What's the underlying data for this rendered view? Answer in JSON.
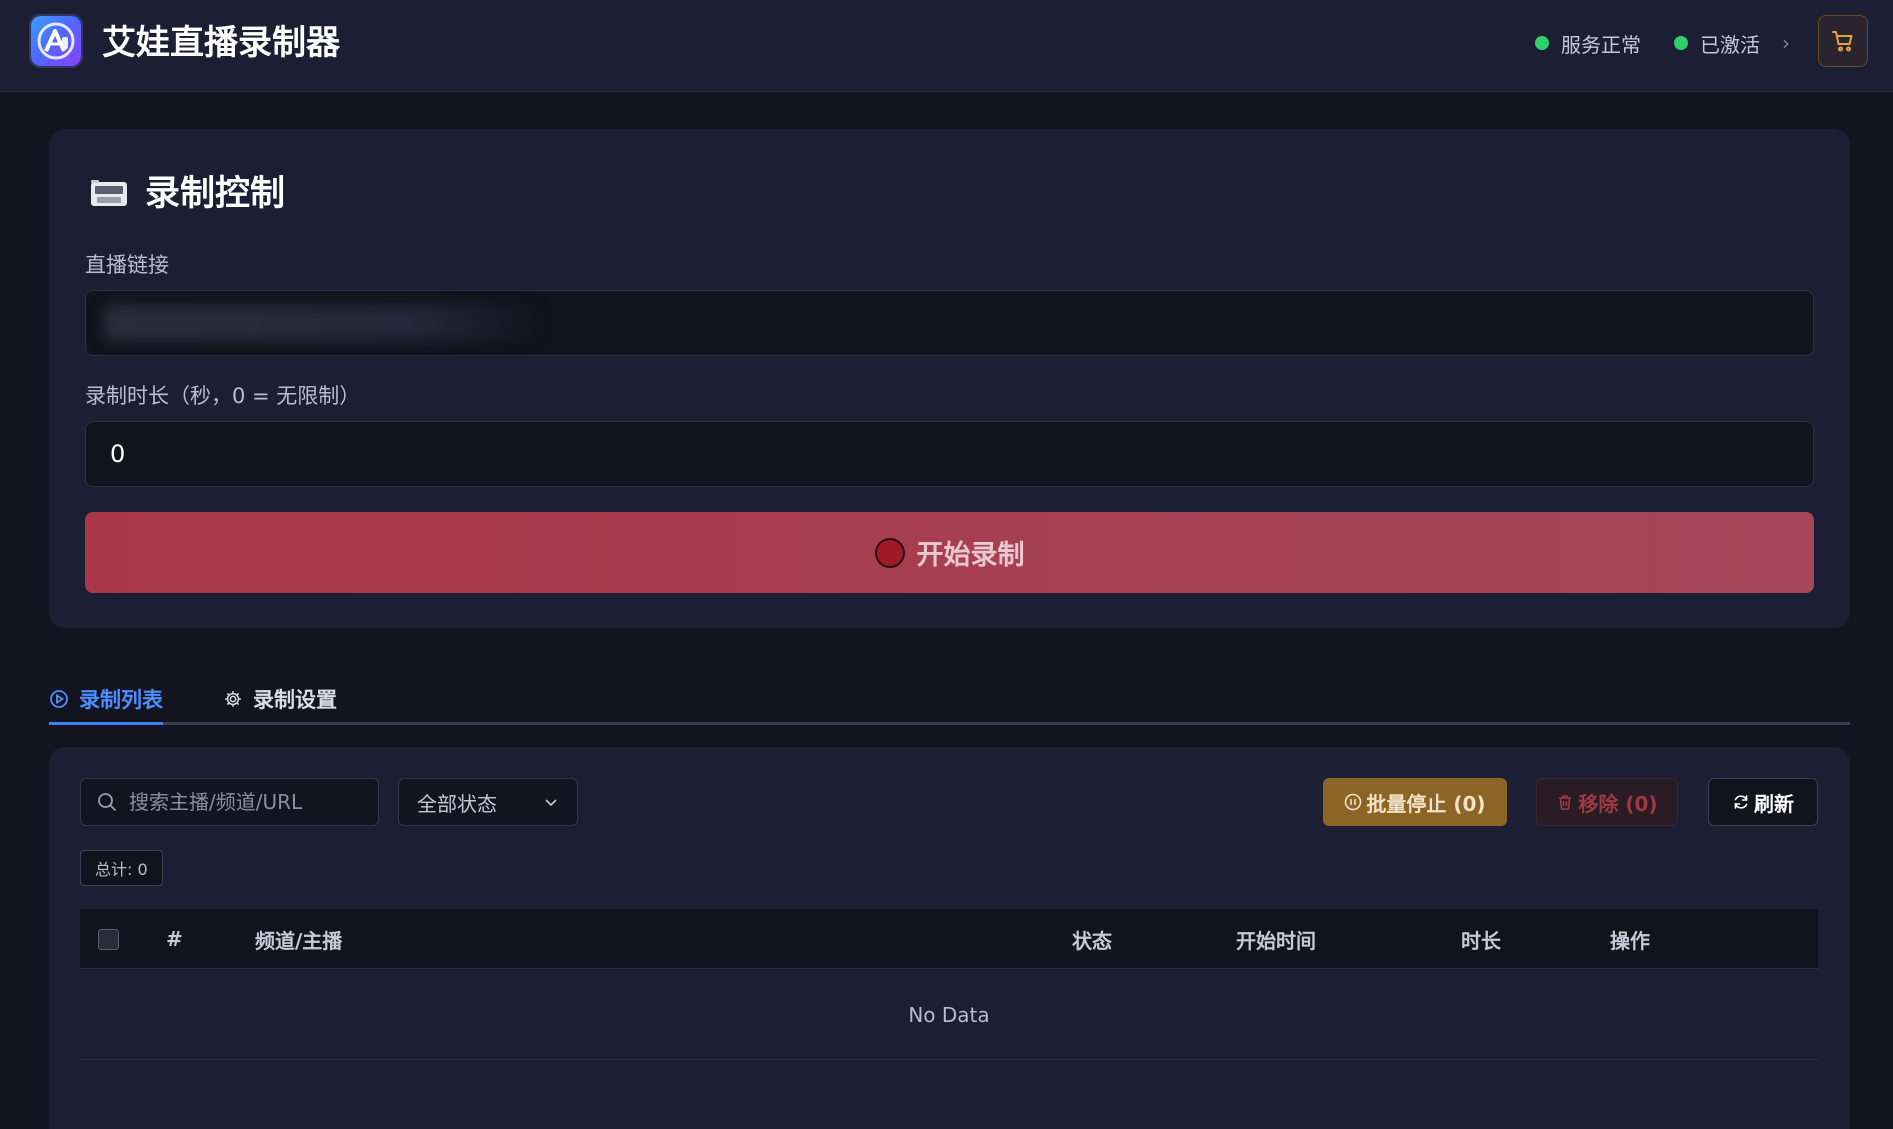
{
  "header": {
    "app_title": "艾娃直播录制器",
    "status_service": "服务正常",
    "status_activated": "已激活",
    "chevron": "›",
    "icons": {
      "logo": "app-logo-icon",
      "cart": "cart-icon"
    },
    "colors": {
      "status_ok": "#2fcf6a",
      "cart_accent": "#e8a23a"
    }
  },
  "control": {
    "title": "录制控制",
    "link_label": "直播链接",
    "link_value": "",
    "duration_label": "录制时长（秒，0 = 无限制）",
    "duration_value": "0",
    "start_button": "开始录制",
    "colors": {
      "start_button": "#a93748",
      "record_dot": "#a11828"
    }
  },
  "tabs": [
    {
      "label": "录制列表",
      "icon": "play-circle-icon",
      "active": true
    },
    {
      "label": "录制设置",
      "icon": "gear-icon",
      "active": false
    }
  ],
  "toolbar": {
    "search_placeholder": "搜索主播/频道/URL",
    "status_filter": "全部状态",
    "batch_stop": "批量停止 (0)",
    "remove": "移除 (0)",
    "refresh": "刷新",
    "total": "总计: 0"
  },
  "table": {
    "columns": [
      "#",
      "频道/主播",
      "状态",
      "开始时间",
      "时长",
      "操作"
    ],
    "rows": [],
    "empty_text": "No Data"
  },
  "accent": "#3b82f6"
}
